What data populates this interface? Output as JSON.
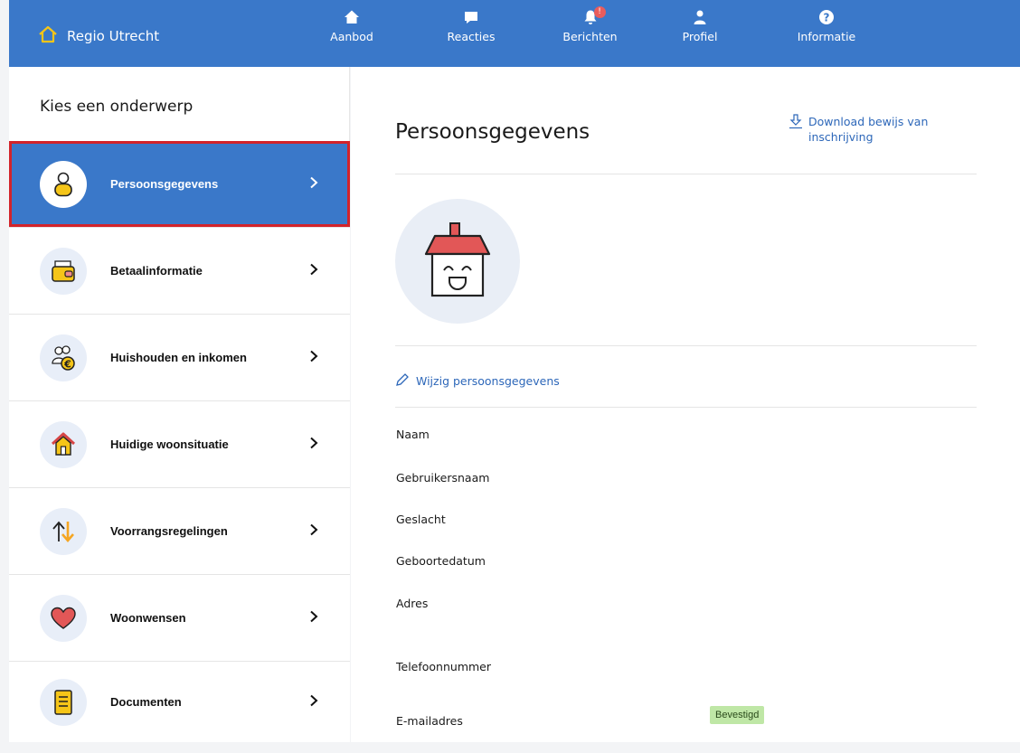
{
  "header": {
    "brand": "Regio Utrecht",
    "nav": [
      {
        "label": "Aanbod",
        "icon": "home-icon"
      },
      {
        "label": "Reacties",
        "icon": "chat-icon"
      },
      {
        "label": "Berichten",
        "icon": "bell-icon",
        "badge": "!"
      },
      {
        "label": "Profiel",
        "icon": "user-icon"
      },
      {
        "label": "Informatie",
        "icon": "help-icon"
      }
    ]
  },
  "sidebar": {
    "title": "Kies een onderwerp",
    "items": [
      {
        "label": "Persoonsgegevens",
        "icon": "person-icon",
        "active": true
      },
      {
        "label": "Betaalinformatie",
        "icon": "wallet-icon"
      },
      {
        "label": "Huishouden en inkomen",
        "icon": "household-income-icon"
      },
      {
        "label": "Huidige woonsituatie",
        "icon": "house-icon"
      },
      {
        "label": "Voorrangsregelingen",
        "icon": "priority-arrows-icon"
      },
      {
        "label": "Woonwensen",
        "icon": "heart-icon"
      },
      {
        "label": "Documenten",
        "icon": "document-icon"
      }
    ]
  },
  "main": {
    "title": "Persoonsgegevens",
    "download_link": "Download bewijs van inschrijving",
    "edit_link": "Wijzig persoonsgegevens",
    "fields": [
      {
        "label": "Naam"
      },
      {
        "label": "Gebruikersnaam"
      },
      {
        "label": "Geslacht"
      },
      {
        "label": "Geboortedatum"
      },
      {
        "label": "Adres"
      },
      {
        "label": "Telefoonnummer"
      },
      {
        "label": "E-mailadres",
        "status": "Bevestigd"
      }
    ]
  },
  "colors": {
    "brand_blue": "#3a78c9",
    "active_outline": "#d2232a",
    "link_blue": "#2d67b9",
    "confirmed_badge": "#bfe7a6",
    "notification_red": "#e85c5c"
  }
}
